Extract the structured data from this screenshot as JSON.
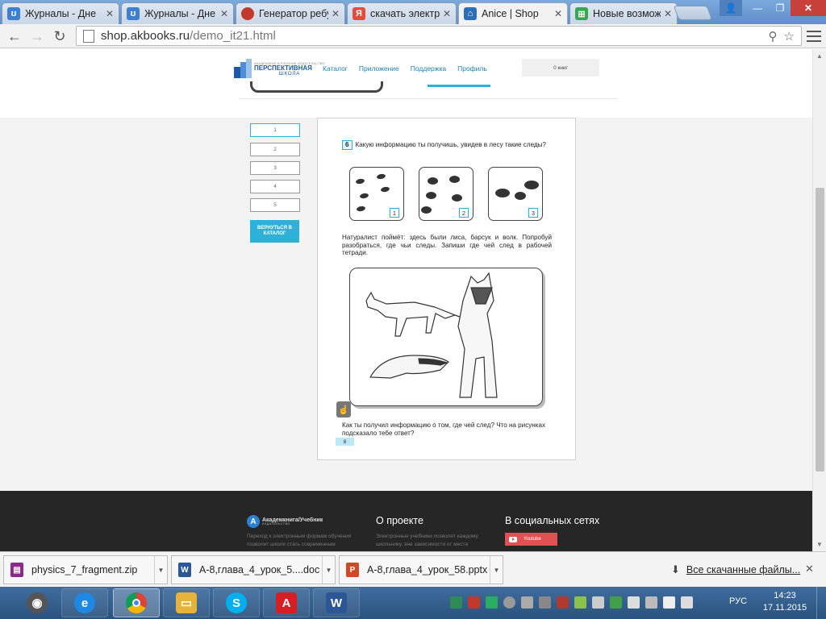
{
  "browser": {
    "tabs": [
      {
        "title": "Журналы - Дне",
        "favicon": "diary-favicon",
        "color": "#3f7fd0"
      },
      {
        "title": "Журналы - Дне",
        "favicon": "diary-favicon",
        "color": "#3f7fd0"
      },
      {
        "title": "Генератор ребу",
        "favicon": "rebus-favicon",
        "color": "#c0392b"
      },
      {
        "title": "скачать электр",
        "favicon": "yandex-favicon",
        "color": "#e64a3b"
      },
      {
        "title": "Anice | Shop",
        "favicon": "anice-favicon",
        "color": "#2a6fb8"
      },
      {
        "title": "Новые возмож",
        "favicon": "windows-favicon",
        "color": "#36a853"
      }
    ],
    "address": {
      "domain": "shop.akbooks.ru",
      "path": "/demo_it21.html"
    }
  },
  "site": {
    "logo": {
      "small": "АКАДЕМКНИГА/УЧЕБНИК ИЗДАТЕЛЬСТВО",
      "main": "ПЕРСПЕКТИВНАЯ",
      "sub": "ШКОЛА"
    },
    "nav": [
      "Каталог",
      "Приложение",
      "Поддержка",
      "Профиль"
    ],
    "cart": "0 книг",
    "pages": [
      "1",
      "2",
      "3",
      "4",
      "5"
    ],
    "return_button": "ВЕРНУТЬСЯ В КАТАЛОГ"
  },
  "book": {
    "question_number": "6",
    "question": "Какую информацию ты получишь, увидев в лесу такие следы?",
    "track_labels": [
      "1",
      "2",
      "3"
    ],
    "naturalist_text": "Натуралист поймёт: здесь были лиса, барсук и волк. Попробуй разобраться, где чьи следы. Запиши где чей след в рабочей тетради.",
    "final_question": "Как ты получил информацию о том, где чей след? Что на рисунках подсказало тебе ответ?",
    "page_number": "8"
  },
  "footer": {
    "logo_main": "Академкнига/Учебник",
    "logo_sub": "ИЗДАТЕЛЬСТВО",
    "col1_text": "Переход к электронным формам обучения позволит школе стать современным",
    "about_heading": "О проекте",
    "about_text": "Электронные учебники позволят каждому школьнику, вне зависимости от места",
    "social_heading": "В социальных сетях",
    "youtube": "Youtube"
  },
  "downloads": {
    "items": [
      {
        "name": "physics_7_fragment.zip",
        "icon": "winrar-icon",
        "color": "#8b2a8b"
      },
      {
        "name": "А-8,глава_4_урок_5....doc",
        "icon": "word-doc-icon",
        "color": "#2b5797"
      },
      {
        "name": "А-8,глава_4_урок_58.pptx",
        "icon": "powerpoint-icon",
        "color": "#d24726"
      }
    ],
    "all_label": "Все скачанные файлы..."
  },
  "taskbar": {
    "apps": [
      {
        "name": "speaker-app-icon",
        "color": "#555555"
      },
      {
        "name": "internet-explorer-icon",
        "color": "#1e88e5"
      },
      {
        "name": "chrome-icon",
        "color": "#db4437"
      },
      {
        "name": "file-explorer-icon",
        "color": "#e6b33a"
      },
      {
        "name": "skype-icon",
        "color": "#00aff0"
      },
      {
        "name": "acrobat-icon",
        "color": "#d71e25"
      },
      {
        "name": "word-icon",
        "color": "#2b5797"
      }
    ],
    "language": "РУС",
    "time": "14:23",
    "date": "17.11.2015"
  }
}
